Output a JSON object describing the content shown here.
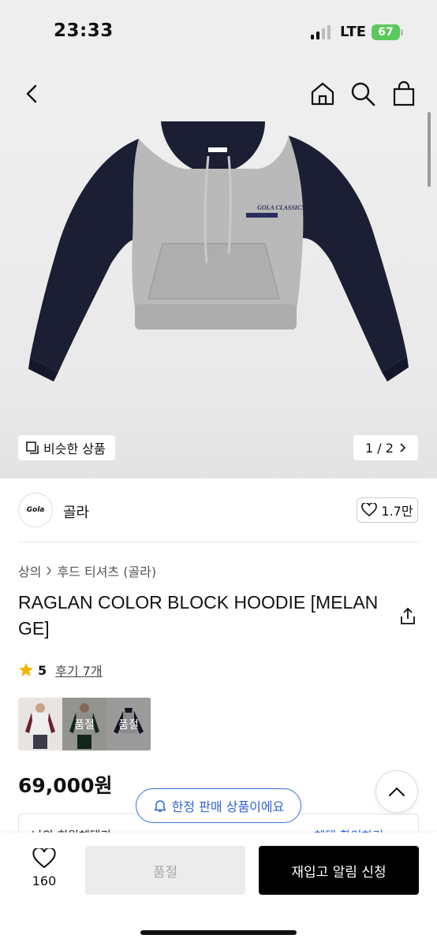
{
  "status_bar": {
    "time": "23:33",
    "network": "LTE",
    "battery": "67"
  },
  "header": {
    "back_icon": "chevron-left-icon",
    "icons": [
      "home-icon",
      "search-icon",
      "shopping-bag-icon"
    ]
  },
  "gallery": {
    "similar_label": "비슷한 상품",
    "pager": "1 / 2",
    "image_brand_text": "GOLA CLASSICS"
  },
  "brand": {
    "logo_text": "Gola",
    "name": "골라",
    "likes": "1.7만"
  },
  "breadcrumb": [
    "상의",
    "후드 티셔츠 (골라)"
  ],
  "product": {
    "title": "RAGLAN COLOR BLOCK HOODIE [MELANGE]",
    "rating": "5",
    "reviews": "후기 7개",
    "price": "69,000원"
  },
  "color_thumbs": [
    {
      "name": "burgundy",
      "sold_out": ""
    },
    {
      "name": "green",
      "sold_out": "품절"
    },
    {
      "name": "navy",
      "sold_out": "품절"
    }
  ],
  "toast": {
    "text": "한정 판매 상품이에요"
  },
  "peek_card": {
    "left": "나의 회원혜택가",
    "right": "혜택 확인하기"
  },
  "bottom_bar": {
    "wish_count": "160",
    "soldout_label": "품절",
    "restock_label": "재입고 알림 신청"
  },
  "colors": {
    "accent_blue": "#2f62d8",
    "star": "#f4b400",
    "battery": "#5ac85a"
  }
}
